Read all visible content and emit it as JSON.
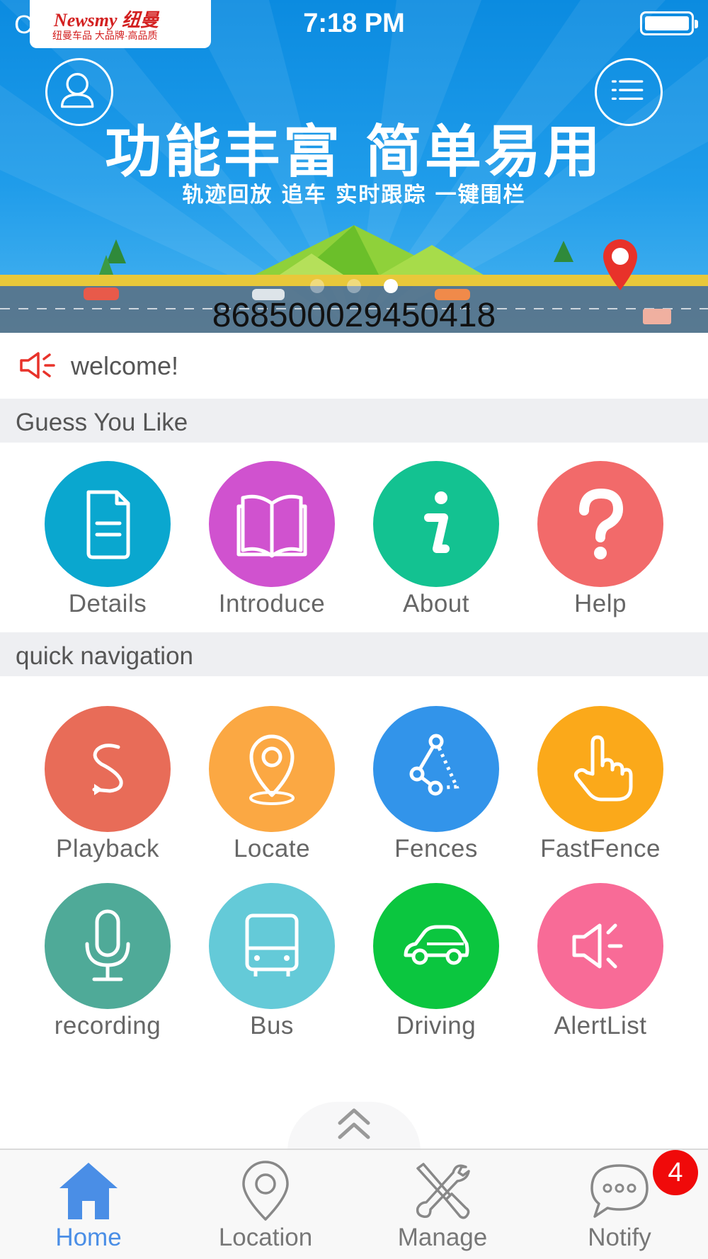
{
  "status_bar": {
    "carrier": "C",
    "time": "7:18 PM"
  },
  "logo": {
    "brand_text": "Newsmy 纽曼",
    "tagline": "纽曼车品 大品牌·高品质"
  },
  "banner": {
    "title": "功能丰富 简单易用",
    "subtitle": "轨迹回放 追车 实时跟踪 一键围栏",
    "device_id": "868500029450418",
    "active_dot": 3,
    "dot_count": 3
  },
  "marquee": {
    "text": "welcome!",
    "icon": "speaker-icon"
  },
  "sections": {
    "guess": {
      "title": "Guess You Like",
      "items": [
        {
          "label": "Details",
          "icon": "document-icon",
          "color": "#0aa7cf"
        },
        {
          "label": "Introduce",
          "icon": "book-icon",
          "color": "#d052cf"
        },
        {
          "label": "About",
          "icon": "info-icon",
          "color": "#13c291"
        },
        {
          "label": "Help",
          "icon": "question-icon",
          "color": "#f26a6a"
        }
      ]
    },
    "quick": {
      "title": "quick navigation",
      "items": [
        {
          "label": "Playback",
          "icon": "playback-icon",
          "color": "#e86c58"
        },
        {
          "label": "Locate",
          "icon": "location-pin-icon",
          "color": "#fba843"
        },
        {
          "label": "Fences",
          "icon": "fence-icon",
          "color": "#3294ea"
        },
        {
          "label": "FastFence",
          "icon": "hand-pointer-icon",
          "color": "#fba91a"
        },
        {
          "label": "recording",
          "icon": "microphone-icon",
          "color": "#4faa98"
        },
        {
          "label": "Bus",
          "icon": "bus-icon",
          "color": "#64cad8"
        },
        {
          "label": "Driving",
          "icon": "car-icon",
          "color": "#0bc63f"
        },
        {
          "label": "AlertList",
          "icon": "alert-speaker-icon",
          "color": "#f86b97"
        }
      ]
    }
  },
  "tabbar": {
    "active": "Home",
    "accent_color": "#4a8ee6",
    "tabs": [
      {
        "label": "Home",
        "icon": "home-icon"
      },
      {
        "label": "Location",
        "icon": "map-pin-icon"
      },
      {
        "label": "Manage",
        "icon": "tools-icon"
      },
      {
        "label": "Notify",
        "icon": "chat-bubble-icon"
      }
    ],
    "notify_badge": "4"
  }
}
